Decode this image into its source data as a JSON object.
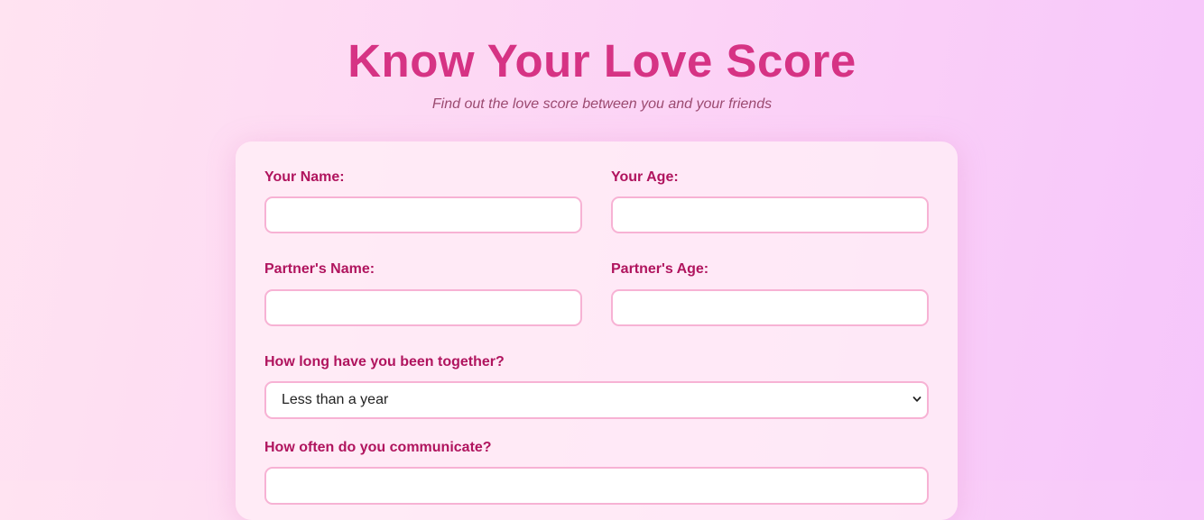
{
  "header": {
    "title": "Know Your Love Score",
    "subtitle": "Find out the love score between you and your friends"
  },
  "form": {
    "your_name_label": "Your Name:",
    "your_age_label": "Your Age:",
    "partner_name_label": "Partner's Name:",
    "partner_age_label": "Partner's Age:",
    "together_label": "How long have you been together?",
    "together_value": "Less than a year",
    "communicate_label": "How often do you communicate?"
  },
  "colors": {
    "accent": "#d63384",
    "label": "#b0145e",
    "border": "#f7b2d4"
  },
  "icons": {
    "select_arrow": "chevron-down-icon"
  }
}
